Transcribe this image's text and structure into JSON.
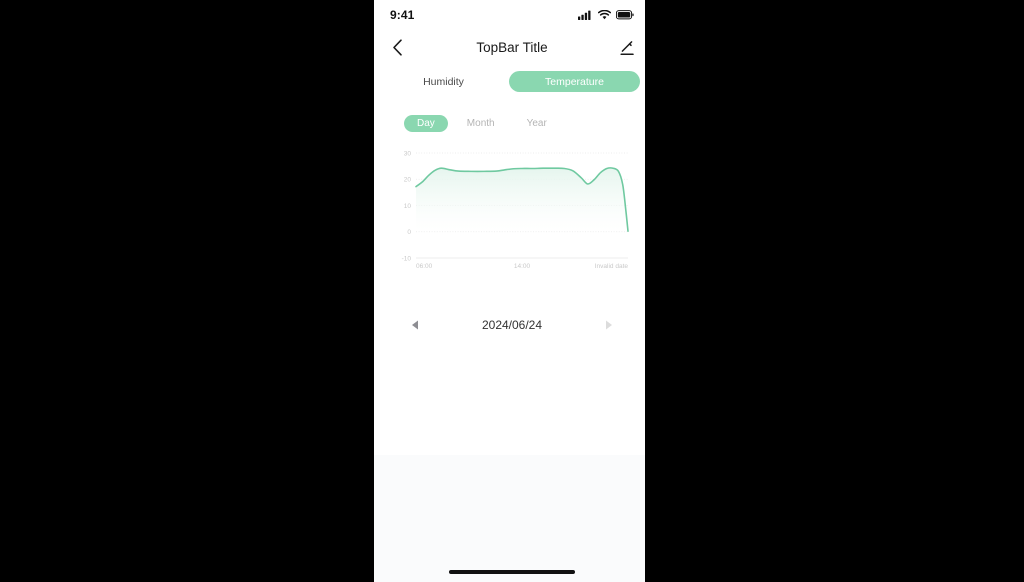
{
  "status_bar": {
    "time": "9:41",
    "icons": [
      "cellular-signal-icon",
      "wifi-icon",
      "battery-icon"
    ]
  },
  "nav_bar": {
    "back_icon": "chevron-left-icon",
    "title": "TopBar Title",
    "edit_icon": "pencil-edit-icon"
  },
  "metric_tabs": {
    "items": [
      {
        "label": "Humidity",
        "active": false
      },
      {
        "label": "Temperature",
        "active": true
      }
    ]
  },
  "range_tabs": {
    "items": [
      {
        "label": "Day",
        "active": true
      },
      {
        "label": "Month",
        "active": false
      },
      {
        "label": "Year",
        "active": false
      }
    ]
  },
  "date_nav": {
    "prev_icon": "triangle-left-icon",
    "date": "2024/06/24",
    "next_icon": "triangle-right-icon"
  },
  "colors": {
    "accent": "#8ad7b0",
    "line": "#6fc9a0",
    "area_top": "#e7f6ee",
    "area_bottom": "#ffffff",
    "grid": "#e9e9e9",
    "tick_text": "#c9c9c9",
    "card_bg": "#ffffff",
    "page_bg": "#fafbfc"
  },
  "chart_data": {
    "type": "area",
    "title": "",
    "xlabel": "",
    "ylabel": "",
    "ylim": [
      -10,
      30
    ],
    "yticks": [
      30,
      20,
      10,
      0,
      -10
    ],
    "xticks": [
      "06:00",
      "14:00",
      "Invalid date"
    ],
    "xtick_positions": [
      0.0,
      0.5,
      1.0
    ],
    "grid": true,
    "legend": "none",
    "series": [
      {
        "name": "Temperature",
        "x": [
          0.0,
          0.03,
          0.06,
          0.09,
          0.12,
          0.16,
          0.2,
          0.26,
          0.32,
          0.38,
          0.42,
          0.46,
          0.5,
          0.55,
          0.6,
          0.65,
          0.7,
          0.74,
          0.78,
          0.81,
          0.84,
          0.87,
          0.9,
          0.93,
          0.955,
          0.975,
          0.99,
          1.0
        ],
        "values": [
          17.2,
          19.0,
          21.5,
          23.4,
          24.2,
          23.6,
          23.1,
          23.0,
          23.0,
          23.1,
          23.6,
          24.0,
          24.1,
          24.1,
          24.2,
          24.2,
          24.1,
          23.2,
          20.5,
          18.2,
          19.8,
          22.5,
          24.1,
          24.2,
          23.0,
          18.0,
          8.0,
          0.2
        ]
      }
    ]
  }
}
